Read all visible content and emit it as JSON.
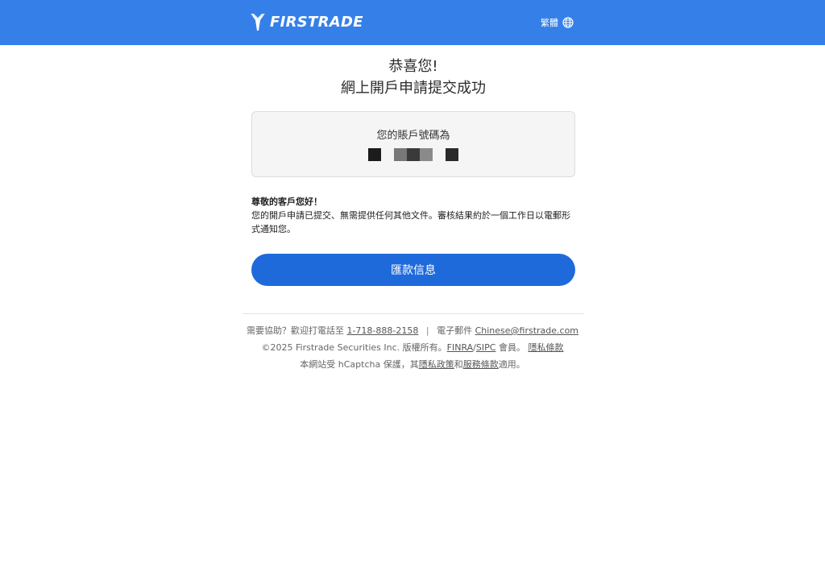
{
  "header": {
    "brand": "FIRSTRADE",
    "language": "繁體",
    "brand_color": "#3580e8"
  },
  "main": {
    "title_line1": "恭喜您!",
    "title_line2": "網上開戶申請提交成功",
    "account_label": "您的賬戶號碼為",
    "greeting_title": "尊敬的客戶您好！",
    "greeting_body": "您的開戶申請已提交、無需提供任何其他文件。審核結果約於一個工作日以電郵形式通知您。",
    "cta_label": "匯款信息",
    "cta_color": "#1e6adb"
  },
  "footer": {
    "help_prefix": "需要協助？歡迎打電話至",
    "phone": "1-718-888-2158",
    "sep": "|",
    "email_prefix": "電子郵件",
    "email": "Chinese@firstrade.com",
    "copyright": "©2025 Firstrade Securities Inc. 版權所有。",
    "finra": "FINRA",
    "slash": "/",
    "sipc": "SIPC",
    "member": "會員。",
    "privacy": "隱私條款",
    "hcaptcha_prefix": "本網站受 hCaptcha 保護，其",
    "privacy_policy": "隱私政策",
    "and": "和",
    "terms": "服務條款",
    "hcaptcha_suffix": "適用。"
  },
  "icons": {
    "logo": "firstrade-logo-icon",
    "language": "globe-icon"
  }
}
